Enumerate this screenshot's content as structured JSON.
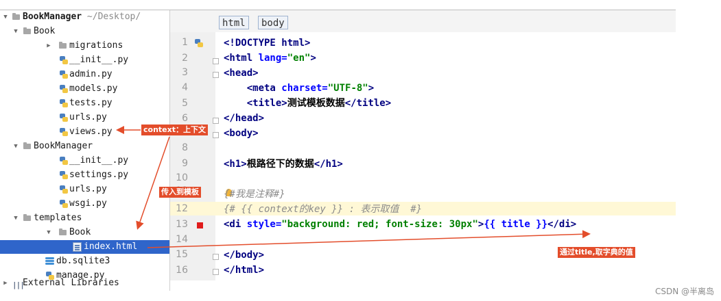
{
  "tree": {
    "rows": [
      {
        "label": "BookManager",
        "suffix": " ~/Desktop/",
        "bold": true
      },
      {
        "label": "Book"
      },
      {
        "label": "migrations"
      },
      {
        "label": "__init__.py"
      },
      {
        "label": "admin.py"
      },
      {
        "label": "models.py"
      },
      {
        "label": "tests.py"
      },
      {
        "label": "urls.py"
      },
      {
        "label": "views.py"
      },
      {
        "label": "BookManager"
      },
      {
        "label": "__init__.py"
      },
      {
        "label": "settings.py"
      },
      {
        "label": "urls.py"
      },
      {
        "label": "wsgi.py"
      },
      {
        "label": "templates"
      },
      {
        "label": "Book"
      },
      {
        "label": "index.html"
      },
      {
        "label": "db.sqlite3"
      },
      {
        "label": "manage.py"
      },
      {
        "label": "External Libraries"
      }
    ]
  },
  "editor": {
    "breadcrumbs": [
      "html",
      "body"
    ],
    "line_numbers": [
      "1",
      "2",
      "3",
      "4",
      "5",
      "6",
      "7",
      "8",
      "9",
      "10",
      "11",
      "12",
      "13",
      "14",
      "15",
      "16"
    ],
    "lines": {
      "l1": "<!DOCTYPE html>",
      "l2a": "<html ",
      "l2b": "lang=",
      "l2c": "\"en\"",
      "l2d": ">",
      "l3": "<head>",
      "l4a": "    <meta ",
      "l4b": "charset=",
      "l4c": "\"UTF-8\"",
      "l4d": ">",
      "l5a": "    <title>",
      "l5b": "测试模板数据",
      "l5c": "</title>",
      "l6": "</head>",
      "l7": "<body>",
      "l9a": "<h1>",
      "l9b": "根路径下的数据",
      "l9c": "</h1>",
      "l11": "{#我是注释#}",
      "l12": "{# {{ context的key }} : 表示取值  #}",
      "l13a": "<di ",
      "l13b": "style=",
      "l13c": "\"background: red; font-size: 30px\"",
      "l13d": ">",
      "l13e": "{{ title }}",
      "l13f": "</di>",
      "l15": "</body>",
      "l16": "</html>"
    }
  },
  "annotations": {
    "context": "context：上下文",
    "pass_template": "传入到模板",
    "via_title": "通过title,取字典的值"
  },
  "watermark": "CSDN @半离岛",
  "colors": {
    "selection": "#2f65ca",
    "annotation": "#e34d2b",
    "current_line": "#fff8d6"
  }
}
